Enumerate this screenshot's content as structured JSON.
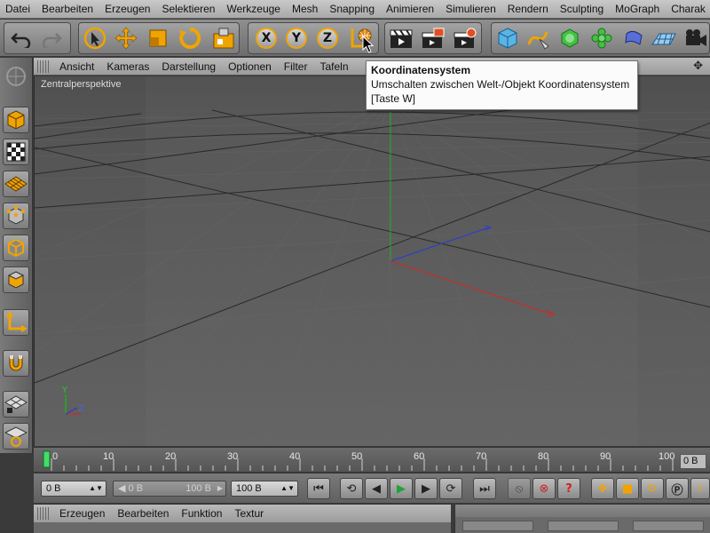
{
  "menubar": {
    "items": [
      "Datei",
      "Bearbeiten",
      "Erzeugen",
      "Selektieren",
      "Werkzeuge",
      "Mesh",
      "Snapping",
      "Animieren",
      "Simulieren",
      "Rendern",
      "Sculpting",
      "MoGraph",
      "Charak"
    ]
  },
  "toolbar": {
    "axis_x": "X",
    "axis_y": "Y",
    "axis_z": "Z"
  },
  "viewport_menu": {
    "items": [
      "Ansicht",
      "Kameras",
      "Darstellung",
      "Optionen",
      "Filter",
      "Tafeln"
    ]
  },
  "viewport": {
    "label": "Zentralperspektive",
    "axis_y": "Y",
    "axis_z": "Z",
    "colors": {
      "x_axis": "#c03030",
      "y_axis": "#22aa22",
      "z_axis": "#3040c0",
      "grid": "#2a2a2a"
    }
  },
  "tooltip": {
    "title": "Koordinatensystem",
    "description": "Umschalten zwischen Welt-/Objekt Koordinatensystem",
    "shortcut": "[Taste W]"
  },
  "timeline": {
    "ticks": [
      "0",
      "10",
      "20",
      "30",
      "40",
      "50",
      "60",
      "70",
      "80",
      "90",
      "100"
    ],
    "end_frame": "0 B"
  },
  "transport": {
    "current_frame": "0 B",
    "range_start": "0 B",
    "range_end": "100 B",
    "max_frame": "100 B"
  },
  "bottom_menu": {
    "items": [
      "Erzeugen",
      "Bearbeiten",
      "Funktion",
      "Textur"
    ]
  },
  "colors": {
    "accent": "#f0a400",
    "play": "#1fa33a",
    "record": "#d02020"
  }
}
